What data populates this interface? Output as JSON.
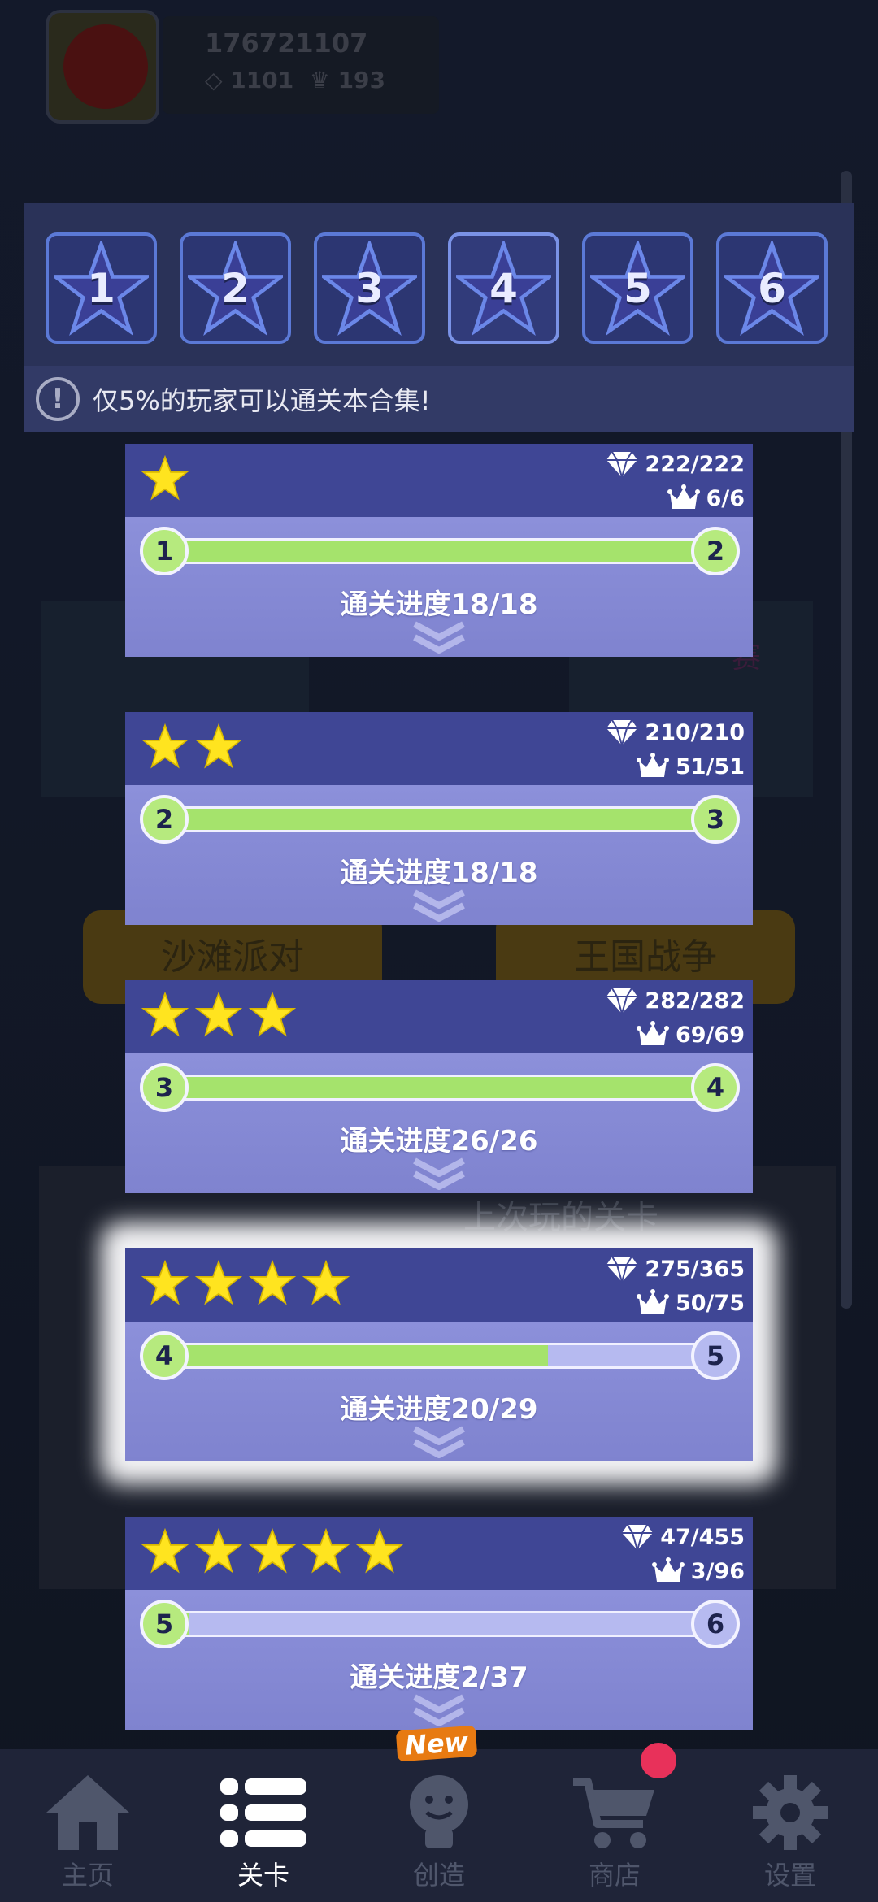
{
  "profile": {
    "user_id": "176721107",
    "gems": "1101",
    "crowns": "193"
  },
  "background": {
    "button_left": "沙滩派对",
    "button_right": "王国战争",
    "last_played": "上次玩的关卡"
  },
  "star_tabs": [
    "1",
    "2",
    "3",
    "4",
    "5",
    "6"
  ],
  "selected_tab": "4",
  "notice": {
    "icon": "!",
    "text": "仅5%的玩家可以通关本合集!"
  },
  "levels": [
    {
      "stars": 1,
      "gems": "222/222",
      "crowns": "6/6",
      "from": "1",
      "to": "2",
      "progress_text": "通关进度18/18",
      "progress": 1.0
    },
    {
      "stars": 2,
      "gems": "210/210",
      "crowns": "51/51",
      "from": "2",
      "to": "3",
      "progress_text": "通关进度18/18",
      "progress": 1.0
    },
    {
      "stars": 3,
      "gems": "282/282",
      "crowns": "69/69",
      "from": "3",
      "to": "4",
      "progress_text": "通关进度26/26",
      "progress": 1.0
    },
    {
      "stars": 4,
      "gems": "275/365",
      "crowns": "50/75",
      "from": "4",
      "to": "5",
      "progress_text": "通关进度20/29",
      "progress": 0.69
    },
    {
      "stars": 5,
      "gems": "47/455",
      "crowns": "3/96",
      "from": "5",
      "to": "6",
      "progress_text": "通关进度2/37",
      "progress": 0.054
    }
  ],
  "highlighted_level": 4,
  "bottom_nav": [
    {
      "label": "主页",
      "icon": "home-icon"
    },
    {
      "label": "关卡",
      "icon": "list-icon",
      "active": true
    },
    {
      "label": "创造",
      "icon": "lightbulb-icon",
      "badge": "New"
    },
    {
      "label": "商店",
      "icon": "cart-icon",
      "notification": true
    },
    {
      "label": "设置",
      "icon": "gear-icon"
    }
  ],
  "colors": {
    "accent_green": "#a5e36c",
    "card_header": "#3f4695",
    "star_yellow": "#ffe41f",
    "badge_orange": "#e77a12",
    "notify_red": "#e8315a"
  }
}
